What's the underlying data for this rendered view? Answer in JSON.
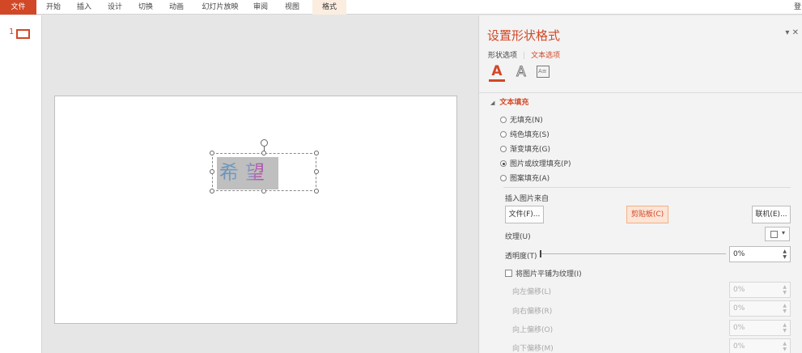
{
  "ribbon": {
    "tabs": [
      "文件",
      "开始",
      "插入",
      "设计",
      "切换",
      "动画",
      "幻灯片放映",
      "审阅",
      "视图",
      "格式"
    ],
    "login": "登"
  },
  "thumbs": {
    "slide_number": "1"
  },
  "slide": {
    "shape_text": "希望"
  },
  "pane": {
    "title": "设置形状格式",
    "controls": "▾ ✕",
    "tab_shape": "形状选项",
    "tab_text": "文本选项",
    "icon_text_fill": "A",
    "icon_text_outline": "A",
    "icon_textbox": "A≡",
    "section": "文本填充",
    "section_arrow": "◢",
    "fills": [
      "无填充(N)",
      "纯色填充(S)",
      "渐变填充(G)",
      "图片或纹理填充(P)",
      "图案填充(A)"
    ],
    "selected_fill": 3,
    "insert_from": "插入图片来自",
    "btn_file": "文件(F)...",
    "btn_clipboard": "剪贴板(C)",
    "btn_online": "联机(E)...",
    "texture": "纹理(U)",
    "transparency": "透明度(T)",
    "transparency_value": "0%",
    "transparency_level": 0,
    "tile_checkbox": "将图片平铺为纹理(I)",
    "offsets": [
      {
        "label": "向左偏移(L)",
        "value": "0%"
      },
      {
        "label": "向右偏移(R)",
        "value": "0%"
      },
      {
        "label": "向上偏移(O)",
        "value": "0%"
      },
      {
        "label": "向下偏移(M)",
        "value": "0%"
      }
    ],
    "spin_arrows": "▲\n▼"
  },
  "colors": {
    "accent": "#d24726",
    "ribbon_bg": "#ffffff",
    "pane_bg": "#f3f3f3"
  }
}
